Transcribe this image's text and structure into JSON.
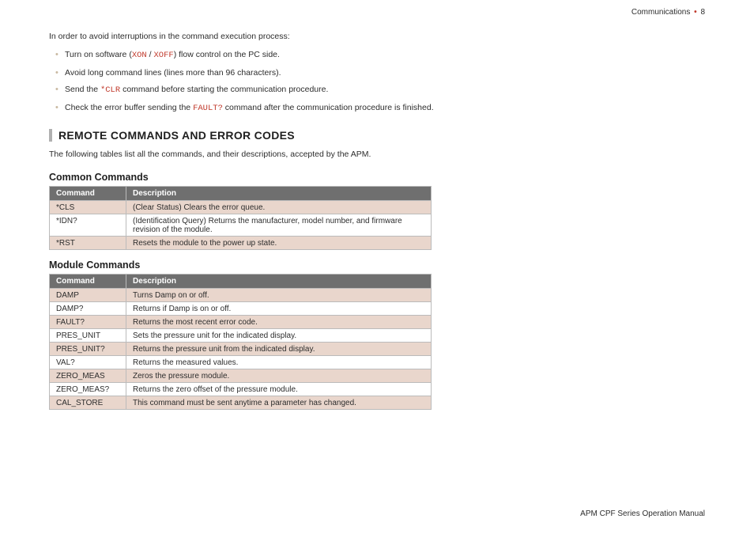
{
  "header": {
    "section": "Communications",
    "page_number": "8"
  },
  "footer": {
    "manual_title": "APM CPF Series Operation Manual"
  },
  "intro": {
    "lead": "In order to avoid interruptions in the command execution process:",
    "bullets": {
      "b1_pre": "Turn on software (",
      "b1_code1": "XON",
      "b1_sep": " / ",
      "b1_code2": "XOFF",
      "b1_post": ") flow control on the PC side.",
      "b2": "Avoid long command lines (lines more than 96 characters).",
      "b3_pre": "Send the ",
      "b3_code": "*CLR",
      "b3_post": " command before starting the communication procedure.",
      "b4_pre": "Check the error buffer sending the ",
      "b4_code": "FAULT?",
      "b4_post": " command after the communication procedure is finished."
    }
  },
  "section": {
    "heading": "REMOTE COMMANDS AND ERROR CODES",
    "desc": "The following tables list all the commands, and their descriptions, accepted by the APM."
  },
  "table_headers": {
    "command": "Command",
    "description": "Description"
  },
  "common": {
    "heading": "Common Commands",
    "rows": [
      {
        "cmd": "*CLS",
        "desc": "(Clear Status) Clears the error queue."
      },
      {
        "cmd": "*IDN?",
        "desc": "(Identification Query) Returns the manufacturer, model number, and firmware revision of the module."
      },
      {
        "cmd": "*RST",
        "desc": "Resets the module to the power up state."
      }
    ]
  },
  "module": {
    "heading": "Module Commands",
    "rows": [
      {
        "cmd": "DAMP",
        "desc": "Turns Damp on or off."
      },
      {
        "cmd": "DAMP?",
        "desc": "Returns if Damp is on or off."
      },
      {
        "cmd": "FAULT?",
        "desc": "Returns the most recent error code."
      },
      {
        "cmd": "PRES_UNIT",
        "desc": "Sets the pressure unit for the indicated display."
      },
      {
        "cmd": "PRES_UNIT?",
        "desc": "Returns the pressure unit from the indicated display."
      },
      {
        "cmd": "VAL?",
        "desc": "Returns the measured values."
      },
      {
        "cmd": "ZERO_MEAS",
        "desc": "Zeros the pressure module."
      },
      {
        "cmd": "ZERO_MEAS?",
        "desc": "Returns the zero offset of the pressure module."
      },
      {
        "cmd": "CAL_STORE",
        "desc": "This command must be sent anytime a parameter has changed."
      }
    ]
  }
}
